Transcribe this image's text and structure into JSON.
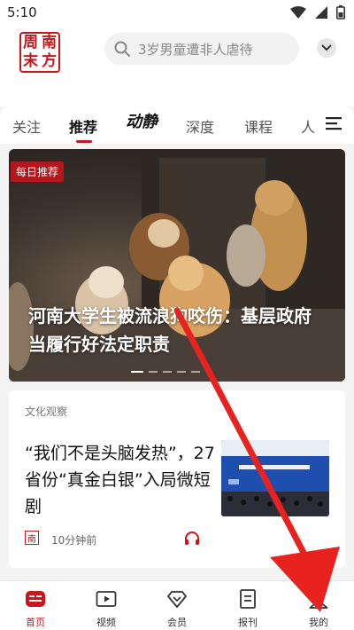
{
  "status_bar": {
    "time": "5:10"
  },
  "header": {
    "logo_chars": [
      "周",
      "南",
      "末",
      "方"
    ],
    "search_placeholder": "3岁男童遭非人虐待"
  },
  "tabs": [
    {
      "label": "关注",
      "active": false
    },
    {
      "label": "推荐",
      "active": true
    },
    {
      "label": "动静",
      "active": false
    },
    {
      "label": "深度",
      "active": false
    },
    {
      "label": "课程",
      "active": false
    },
    {
      "label": "人",
      "active": false
    }
  ],
  "banner": {
    "tag": "每日推荐",
    "title": "河南大学生被流浪狗咬伤：基层政府当履行好法定职责",
    "slide_count": 5,
    "active_slide": 1
  },
  "card": {
    "category": "文化观察",
    "title": "“我们不是头脑发热”，27省份“真金白银”入局微短剧",
    "source_logo": "南",
    "time": "10分钟前"
  },
  "bottom_nav": [
    {
      "label": "首页",
      "icon": "home-news-icon",
      "active": true
    },
    {
      "label": "视频",
      "icon": "video-play-icon",
      "active": false
    },
    {
      "label": "会员",
      "icon": "member-diamond-icon",
      "active": false
    },
    {
      "label": "报刊",
      "icon": "newspaper-icon",
      "active": false
    },
    {
      "label": "我的",
      "icon": "profile-person-icon",
      "active": false
    }
  ],
  "colors": {
    "accent": "#c8161d",
    "annotation_arrow": "#e8231f"
  }
}
